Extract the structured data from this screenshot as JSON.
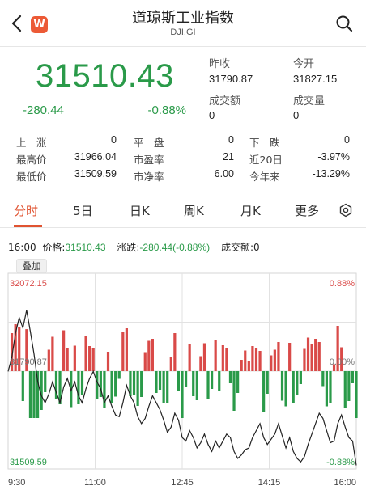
{
  "header": {
    "title": "道琼斯工业指数",
    "code": "DJI.GI",
    "logo_text": "W",
    "brand_color": "#ec5a36"
  },
  "quote": {
    "price": "31510.43",
    "change": "-280.44",
    "change_pct": "-0.88%",
    "prev_close_label": "昨收",
    "prev_close": "31790.87",
    "open_label": "今开",
    "open": "31827.15",
    "turnover_label": "成交额",
    "turnover": "0",
    "volume_label": "成交量",
    "volume": "0",
    "down_color": "#2a9a49"
  },
  "stats": {
    "up_label": "上　涨",
    "up": "0",
    "flat_label": "平　盘",
    "flat": "0",
    "down_label": "下　跌",
    "down": "0",
    "high_label": "最高价",
    "high": "31966.04",
    "pe_label": "市盈率",
    "pe": "21",
    "d20_label": "近20日",
    "d20": "-3.97%",
    "low_label": "最低价",
    "low": "31509.59",
    "pb_label": "市净率",
    "pb": "6.00",
    "ytd_label": "今年来",
    "ytd": "-13.29%"
  },
  "tabs": [
    "分时",
    "5日",
    "日K",
    "周K",
    "月K",
    "更多"
  ],
  "active_tab": 0,
  "accent_color": "#e05331",
  "info_bar": {
    "time": "16:00",
    "price_label": "价格:",
    "price": "31510.43",
    "change_label": "涨跌:",
    "change": "-280.44(-0.88%)",
    "turnover_label": "成交额:",
    "turnover": "0"
  },
  "overlay_label": "叠加",
  "chart_data": {
    "type": "line",
    "y_max_label": "32072.15",
    "y_mid_label": "31790.87",
    "y_min_label": "31509.59",
    "pct_max_label": "0.88%",
    "pct_mid_label": "0.00%",
    "pct_min_label": "-0.88%",
    "x_ticks": [
      "9:30",
      "11:00",
      "12:45",
      "14:15",
      "16:00"
    ],
    "ylim": [
      31509.59,
      32072.15
    ],
    "base": 31790.87,
    "series": [
      {
        "values": [
          31790,
          31830,
          31900,
          31945,
          31915,
          31966,
          31905,
          31840,
          31760,
          31720,
          31700,
          31725,
          31760,
          31730,
          31700,
          31745,
          31770,
          31735,
          31760,
          31720,
          31700,
          31740,
          31770,
          31790,
          31760,
          31740,
          31700,
          31720,
          31690,
          31665,
          31660,
          31700,
          31750,
          31720,
          31700,
          31660,
          31640,
          31655,
          31690,
          31720,
          31700,
          31680,
          31650,
          31615,
          31630,
          31670,
          31650,
          31600,
          31590,
          31620,
          31600,
          31570,
          31585,
          31610,
          31580,
          31560,
          31590,
          31570,
          31590,
          31610,
          31600,
          31560,
          31540,
          31550,
          31565,
          31570,
          31600,
          31620,
          31640,
          31600,
          31580,
          31595,
          31610,
          31640,
          31605,
          31570,
          31600,
          31560,
          31540,
          31530,
          31545,
          31580,
          31610,
          31640,
          31670,
          31655,
          31620,
          31585,
          31590,
          31640,
          31665,
          31630,
          31600,
          31590,
          31520
        ]
      }
    ],
    "up_color": "#d94a48",
    "down_color": "#2a9a49"
  }
}
